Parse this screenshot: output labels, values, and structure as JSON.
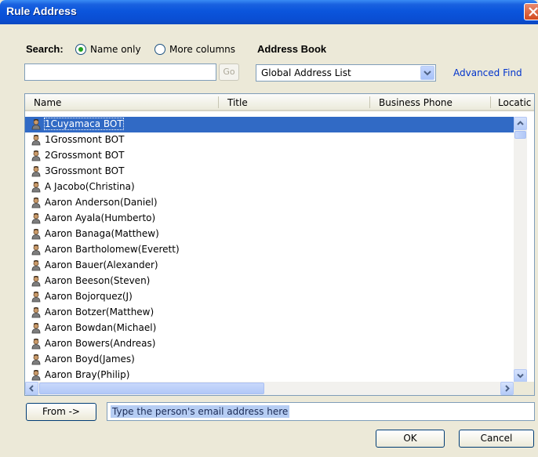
{
  "window": {
    "title": "Rule Address"
  },
  "search": {
    "label": "Search:",
    "options": [
      {
        "label": "Name only",
        "checked": true
      },
      {
        "label": "More columns",
        "checked": false
      }
    ],
    "input_value": "",
    "go_label": "Go"
  },
  "address_book": {
    "label": "Address Book",
    "selected": "Global Address List",
    "advanced_find": "Advanced Find"
  },
  "table": {
    "columns": [
      "Name",
      "Title",
      "Business Phone",
      "Locatic"
    ],
    "rows": [
      "1Cuyamaca BOT",
      "1Grossmont BOT",
      "2Grossmont BOT",
      "3Grossmont BOT",
      "A Jacobo(Christina)",
      "Aaron Anderson(Daniel)",
      "Aaron Ayala(Humberto)",
      "Aaron Banaga(Matthew)",
      "Aaron Bartholomew(Everett)",
      "Aaron Bauer(Alexander)",
      "Aaron Beeson(Steven)",
      "Aaron Bojorquez(J)",
      "Aaron Botzer(Matthew)",
      "Aaron Bowdan(Michael)",
      "Aaron Bowers(Andreas)",
      "Aaron Boyd(James)",
      "Aaron Bray(Philip)"
    ],
    "selected_index": 0
  },
  "footer": {
    "from_label": "From ->",
    "email_value": "Type the person's email address here",
    "ok_label": "OK",
    "cancel_label": "Cancel"
  },
  "colors": {
    "titlebar": "#0a4ed3",
    "selection": "#316ac5",
    "link": "#0033cc"
  }
}
